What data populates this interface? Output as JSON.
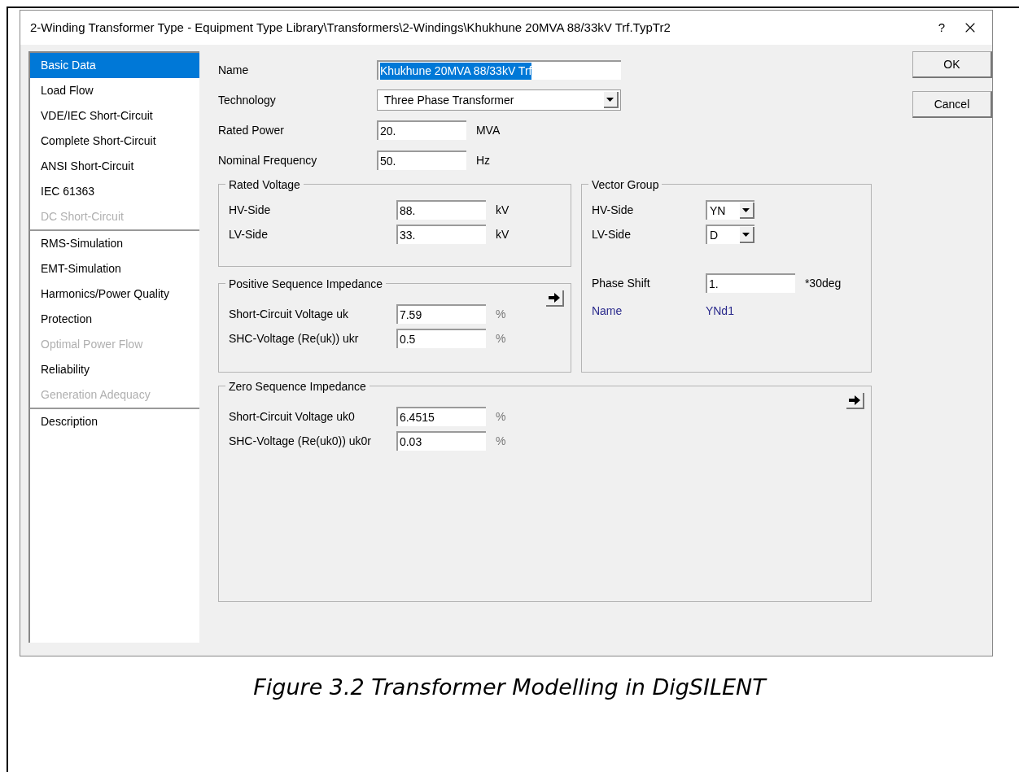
{
  "window": {
    "title": "2-Winding Transformer Type - Equipment Type Library\\Transformers\\2-Windings\\Khukhune 20MVA 88/33kV Trf.TypTr2",
    "help": "?"
  },
  "sidebar": {
    "groups": [
      [
        {
          "label": "Basic Data",
          "selected": true,
          "disabled": false
        },
        {
          "label": "Load Flow",
          "selected": false,
          "disabled": false
        },
        {
          "label": "VDE/IEC Short-Circuit",
          "selected": false,
          "disabled": false
        },
        {
          "label": "Complete Short-Circuit",
          "selected": false,
          "disabled": false
        },
        {
          "label": "ANSI Short-Circuit",
          "selected": false,
          "disabled": false
        },
        {
          "label": "IEC 61363",
          "selected": false,
          "disabled": false
        },
        {
          "label": "DC Short-Circuit",
          "selected": false,
          "disabled": true
        }
      ],
      [
        {
          "label": "RMS-Simulation",
          "selected": false,
          "disabled": false
        },
        {
          "label": "EMT-Simulation",
          "selected": false,
          "disabled": false
        },
        {
          "label": "Harmonics/Power Quality",
          "selected": false,
          "disabled": false
        },
        {
          "label": "Protection",
          "selected": false,
          "disabled": false
        },
        {
          "label": "Optimal Power Flow",
          "selected": false,
          "disabled": true
        },
        {
          "label": "Reliability",
          "selected": false,
          "disabled": false
        },
        {
          "label": "Generation Adequacy",
          "selected": false,
          "disabled": true
        }
      ],
      [
        {
          "label": "Description",
          "selected": false,
          "disabled": false
        }
      ]
    ]
  },
  "fields": [
    {
      "kind": "text",
      "label": "Name",
      "value": "Khukhune 20MVA 88/33kV Trf",
      "highlighted": true
    },
    {
      "kind": "dropdown",
      "label": "Technology",
      "value": "Three Phase Transformer"
    },
    {
      "kind": "number",
      "label": "Rated Power",
      "value": "20.",
      "unit": "MVA"
    },
    {
      "kind": "number",
      "label": "Nominal Frequency",
      "value": "50.",
      "unit": "Hz"
    }
  ],
  "rated_voltage": {
    "title": "Rated Voltage",
    "rows": [
      {
        "label": "HV-Side",
        "value": "88.",
        "unit": "kV"
      },
      {
        "label": "LV-Side",
        "value": "33.",
        "unit": "kV"
      }
    ]
  },
  "vector_group": {
    "title": "Vector Group",
    "rows": [
      {
        "label": "HV-Side",
        "value": "YN"
      },
      {
        "label": "LV-Side",
        "value": "D"
      }
    ],
    "phase_shift": {
      "label": "Phase Shift",
      "value": "1.",
      "unit": "*30deg"
    },
    "name": {
      "label": "Name",
      "value": "YNd1"
    }
  },
  "positive_sequence": {
    "title": "Positive Sequence Impedance",
    "rows": [
      {
        "label": "Short-Circuit Voltage uk",
        "value": "7.59",
        "unit": "%"
      },
      {
        "label": "SHC-Voltage (Re(uk)) ukr",
        "value": "0.5",
        "unit": "%"
      }
    ]
  },
  "zero_sequence": {
    "title": "Zero Sequence Impedance",
    "rows": [
      {
        "label": "Short-Circuit Voltage uk0",
        "value": "6.4515",
        "unit": "%"
      },
      {
        "label": "SHC-Voltage (Re(uk0)) uk0r",
        "value": "0.03",
        "unit": "%"
      }
    ]
  },
  "buttons": [
    "OK",
    "Cancel"
  ],
  "caption": "Figure 3.2 Transformer Modelling in DigSILENT"
}
